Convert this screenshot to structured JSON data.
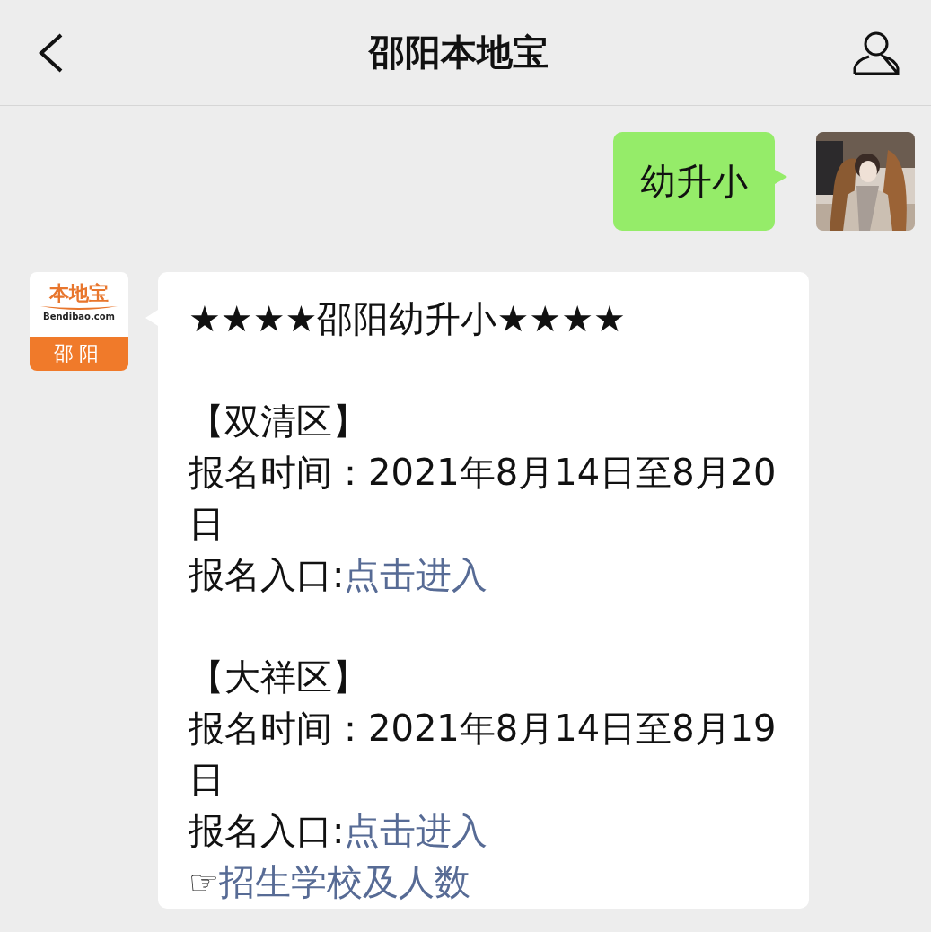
{
  "header": {
    "title": "邵阳本地宝"
  },
  "messages": [
    {
      "kind": "outgoing",
      "text": "幼升小"
    },
    {
      "kind": "incoming",
      "avatar": {
        "brand": "本地宝",
        "site": "Bendibao.com",
        "city": "邵阳"
      },
      "lines": [
        {
          "kind": "text",
          "text": "★★★★邵阳幼升小★★★★"
        },
        {
          "kind": "gap"
        },
        {
          "kind": "text",
          "text": "【双清区】"
        },
        {
          "kind": "text",
          "text": "报名时间：2021年8月14日至8月20日"
        },
        {
          "kind": "entry",
          "label": "报名入口:",
          "link": "点击进入"
        },
        {
          "kind": "gap"
        },
        {
          "kind": "text",
          "text": "【大祥区】"
        },
        {
          "kind": "text",
          "text": "报名时间：2021年8月14日至8月19日"
        },
        {
          "kind": "entry",
          "label": "报名入口:",
          "link": "点击进入"
        },
        {
          "kind": "pointer",
          "mark": "☞",
          "link": "招生学校及人数"
        }
      ]
    }
  ]
}
